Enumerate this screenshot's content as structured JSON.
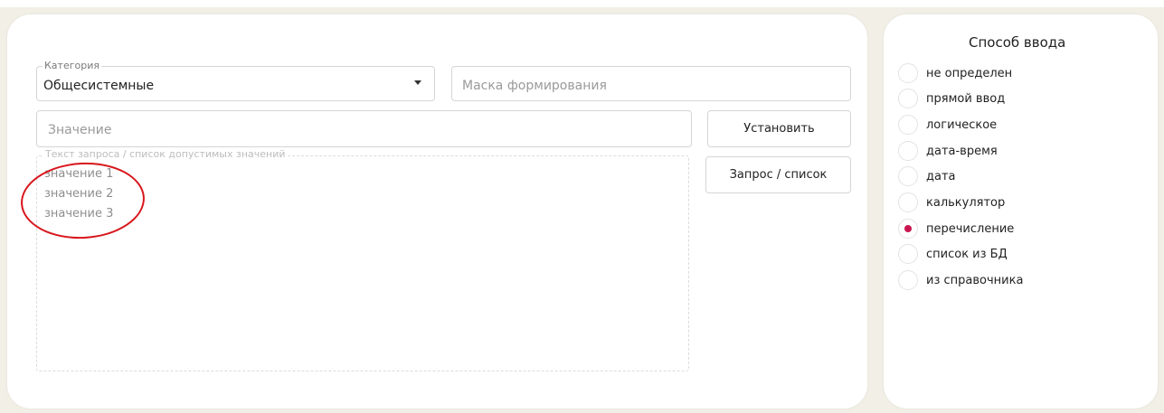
{
  "form": {
    "category": {
      "legend": "Категория",
      "value": "Общесистемные"
    },
    "mask": {
      "placeholder": "Маска формирования"
    },
    "value_field": {
      "placeholder": "Значение"
    },
    "set_button": "Установить",
    "query_button": "Запрос / список",
    "query_text": {
      "legend": "Текст запроса / список допустимых значений",
      "lines": [
        "значение 1",
        "значение 2",
        "значение 3"
      ]
    }
  },
  "input_method": {
    "title": "Способ ввода",
    "options": [
      {
        "label": "не определен",
        "checked": false
      },
      {
        "label": "прямой ввод",
        "checked": false
      },
      {
        "label": "логическое",
        "checked": false
      },
      {
        "label": "дата-время",
        "checked": false
      },
      {
        "label": "дата",
        "checked": false
      },
      {
        "label": "калькулятор",
        "checked": false
      },
      {
        "label": "перечисление",
        "checked": true
      },
      {
        "label": "список из БД",
        "checked": false
      },
      {
        "label": "из справочника",
        "checked": false
      }
    ]
  },
  "colors": {
    "background": "#f1efe6",
    "accent_radio": "#c8174e",
    "annotation": "#d8161c"
  }
}
